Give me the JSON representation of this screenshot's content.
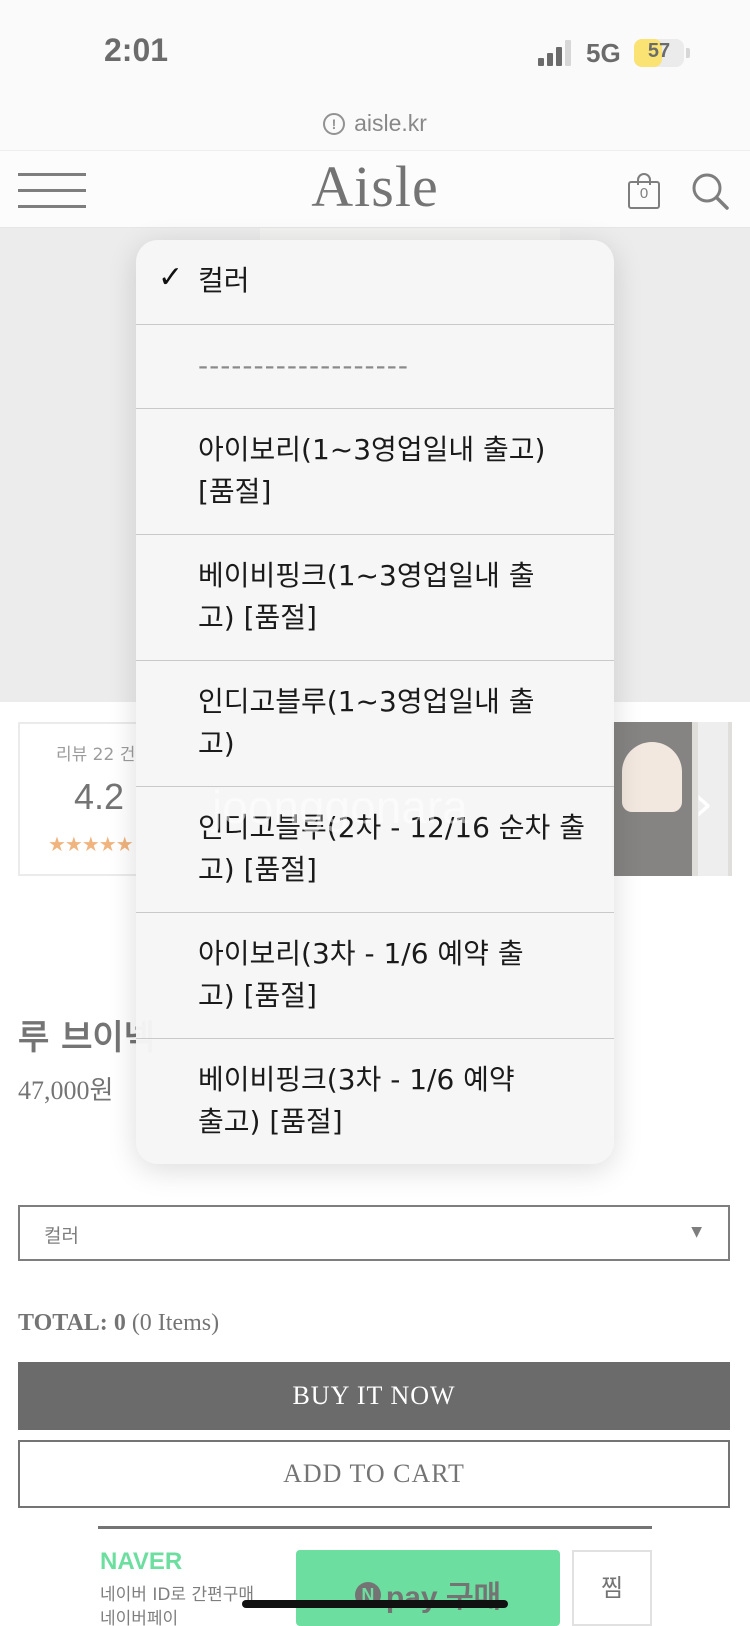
{
  "status_bar": {
    "time": "2:01",
    "network": "5G",
    "battery": "57",
    "battery_level": 0.57
  },
  "browser": {
    "url": "aisle.kr",
    "url_info_icon": "!"
  },
  "header": {
    "logo": "Aisle",
    "cart_count": "0",
    "menu_icon": "hamburger-icon",
    "bag_icon": "shopping-bag-icon",
    "search_icon": "search-icon"
  },
  "reviews": {
    "label": "리뷰 22 건",
    "score": "4.2",
    "stars": "★★★★★",
    "rating_value": 4.2
  },
  "product": {
    "name": "루 브이넥",
    "price": "47,000원"
  },
  "option_select": {
    "value": "컬러",
    "arrow": "▼"
  },
  "total": {
    "label": "TOTAL:",
    "amount": "0",
    "items": "(0 Items)"
  },
  "buttons": {
    "buy_now": "BUY IT NOW",
    "add_to_cart": "ADD TO CART"
  },
  "naver": {
    "logo": "NAVER",
    "line1": "네이버 ID로 간편구매",
    "line2": "네이버페이",
    "pay_n": "N",
    "pay_label": "pay 구매",
    "zzim": "찜"
  },
  "dropdown": {
    "options": [
      {
        "label": "컬러",
        "selected": true
      },
      {
        "label": "-------------------",
        "selected": false
      },
      {
        "label": "아이보리(1~3영업일내 출고) [품절]",
        "selected": false
      },
      {
        "label": "베이비핑크(1~3영업일내 출고) [품절]",
        "selected": false
      },
      {
        "label": "인디고블루(1~3영업일내 출고)",
        "selected": false
      },
      {
        "label": "인디고블루(2차 - 12/16 순차 출고) [품절]",
        "selected": false
      },
      {
        "label": "아이보리(3차 - 1/6 예약 출고) [품절]",
        "selected": false
      },
      {
        "label": "베이비핑크(3차 - 1/6 예약 출고) [품절]",
        "selected": false
      }
    ],
    "check_mark": "✓"
  },
  "watermark": "joonggonara"
}
